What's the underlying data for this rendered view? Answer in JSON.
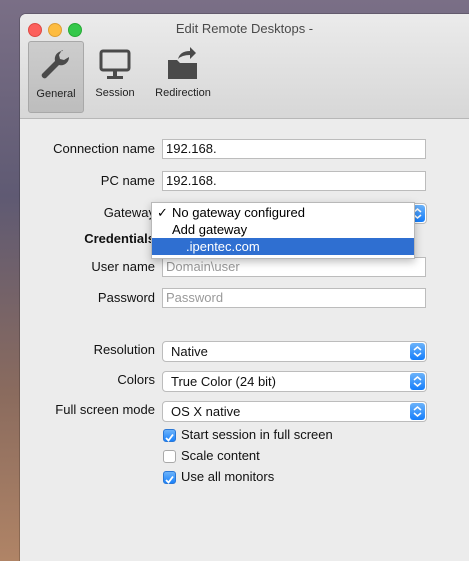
{
  "window": {
    "title": "Edit Remote Desktops -"
  },
  "tabs": [
    {
      "label": "General",
      "icon": "wrench-icon",
      "active": true
    },
    {
      "label": "Session",
      "icon": "monitor-icon",
      "active": false
    },
    {
      "label": "Redirection",
      "icon": "folder-arrow-icon",
      "active": false
    }
  ],
  "form": {
    "connection_name_label": "Connection name",
    "connection_name_value": "192.168.",
    "pc_name_label": "PC name",
    "pc_name_value": "192.168.",
    "gateway_label": "Gateway",
    "credentials_label": "Credentials",
    "user_name_label": "User name",
    "user_name_placeholder": "Domain\\user",
    "password_label": "Password",
    "password_placeholder": "Password",
    "resolution_label": "Resolution",
    "resolution_value": "Native",
    "colors_label": "Colors",
    "colors_value": "True Color (24 bit)",
    "fullscreen_label": "Full screen mode",
    "fullscreen_value": "OS X native",
    "checkboxes": [
      {
        "label": "Start session in full screen",
        "checked": true
      },
      {
        "label": "Scale content",
        "checked": false
      },
      {
        "label": "Use all monitors",
        "checked": true
      }
    ]
  },
  "gateway_dropdown": {
    "items": [
      {
        "label": "No gateway configured",
        "checked": true,
        "highlighted": false
      },
      {
        "label": "Add gateway",
        "checked": false,
        "highlighted": false
      },
      {
        "label": ".ipentec.com",
        "checked": false,
        "highlighted": true
      }
    ]
  },
  "colors": {
    "accent": "#1a82fb",
    "highlight": "#2f6fd1"
  }
}
